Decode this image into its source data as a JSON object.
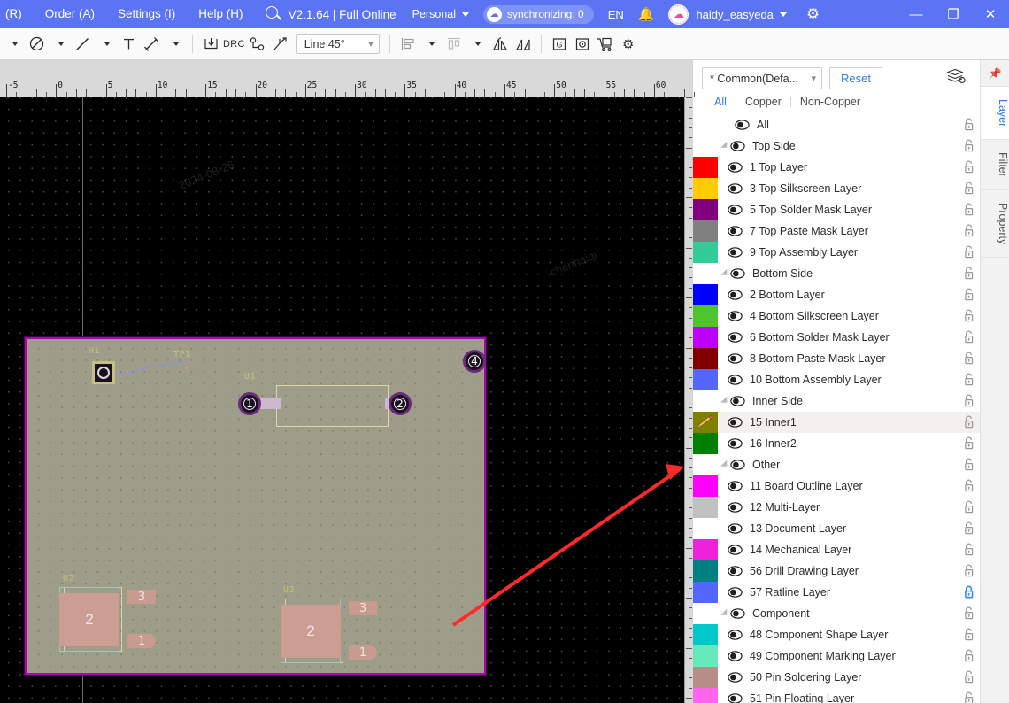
{
  "topbar": {
    "menus": [
      "(R)",
      "Order (A)",
      "Settings (I)",
      "Help (H)"
    ],
    "search_icon": "search-icon",
    "version": "V2.1.64 | Full Online",
    "account_type": "Personal",
    "sync_status": "synchronizing: 0",
    "language": "EN",
    "bell_icon": "bell-icon",
    "username": "haidy_easyeda",
    "gear_icon": "gear-icon",
    "window_minimize": "—",
    "window_restore": "❐",
    "window_close": "✕",
    "bg_color": "#5b74f3"
  },
  "toolbar": {
    "items": [
      {
        "name": "select-tool-caret",
        "glyph": "caret"
      },
      {
        "name": "no-entry-tool",
        "glyph": "circle-slash"
      },
      {
        "name": "no-entry-caret",
        "glyph": "caret"
      },
      {
        "name": "line-tool",
        "glyph": "line"
      },
      {
        "name": "line-caret",
        "glyph": "caret"
      },
      {
        "name": "text-tool",
        "glyph": "T"
      },
      {
        "name": "dimension-tool",
        "glyph": "dimension"
      },
      {
        "name": "dimension-caret",
        "glyph": "caret"
      }
    ],
    "group2": [
      {
        "name": "import-tool",
        "glyph": "import-arrow"
      },
      {
        "name": "drc-tool",
        "glyph": "DRC"
      },
      {
        "name": "net-tool",
        "glyph": "net"
      },
      {
        "name": "route-tool",
        "glyph": "route"
      }
    ],
    "route_mode": "Line 45°",
    "group3": [
      {
        "name": "align-tool",
        "glyph": "align"
      },
      {
        "name": "align-caret",
        "glyph": "caret"
      },
      {
        "name": "distribute-tool",
        "glyph": "distribute"
      },
      {
        "name": "distribute-caret",
        "glyph": "caret"
      },
      {
        "name": "flip-horizontal-tool",
        "glyph": "flip-h"
      },
      {
        "name": "flip-vertical-tool",
        "glyph": "flip-v"
      }
    ],
    "group4": [
      {
        "name": "gerber-export-tool",
        "glyph": "G"
      },
      {
        "name": "bom-tool",
        "glyph": "target-folder"
      },
      {
        "name": "cart-tool",
        "glyph": "cart"
      },
      {
        "name": "settings-tool",
        "glyph": "gear"
      }
    ]
  },
  "canvas": {
    "ruler_unit_labels": [
      "-5",
      "0",
      "5",
      "10",
      "15",
      "20",
      "25",
      "30",
      "35",
      "40",
      "45",
      "50",
      "55",
      "60"
    ],
    "background_color": "#000000",
    "board_fill": "#9d9d8a",
    "board_outline_color": "#b000b0",
    "components": [
      {
        "designator": "H1",
        "type": "mount-hole"
      },
      {
        "designator": "TP1",
        "type": "test-point"
      },
      {
        "designator": "U1",
        "type": "through-hole-ic",
        "pads": [
          "1",
          "2"
        ]
      },
      {
        "designator": "U2",
        "type": "smd",
        "pads": [
          "1",
          "2",
          "3"
        ]
      },
      {
        "designator": "U3",
        "type": "smd",
        "pads": [
          "1",
          "2",
          "3"
        ]
      }
    ],
    "standalone_pads": [
      "4"
    ],
    "annotation_arrow_color": "#ff2a2a"
  },
  "layer_panel": {
    "config_select": "* Common(Defa...",
    "reset_label": "Reset",
    "stack_icon": "layer-stack-icon",
    "filters": [
      "All",
      "Copper",
      "Non-Copper"
    ],
    "active_filter": "All",
    "groups": [
      {
        "name": "All",
        "is_group": false,
        "is_root": true,
        "color": null,
        "children": []
      },
      {
        "name": "Top Side",
        "is_group": true,
        "color": null,
        "children": [
          {
            "name": "1 Top Layer",
            "color": "#ff0000"
          },
          {
            "name": "3 Top Silkscreen Layer",
            "color": "#ffcc00"
          },
          {
            "name": "5 Top Solder Mask Layer",
            "color": "#800080"
          },
          {
            "name": "7 Top Paste Mask Layer",
            "color": "#808080"
          },
          {
            "name": "9 Top Assembly Layer",
            "color": "#33cc99"
          }
        ]
      },
      {
        "name": "Bottom Side",
        "is_group": true,
        "color": null,
        "children": [
          {
            "name": "2 Bottom Layer",
            "color": "#0000ff"
          },
          {
            "name": "4 Bottom Silkscreen Layer",
            "color": "#4cc62c"
          },
          {
            "name": "6 Bottom Solder Mask Layer",
            "color": "#bf00ff"
          },
          {
            "name": "8 Bottom Paste Mask Layer",
            "color": "#800000"
          },
          {
            "name": "10 Bottom Assembly Layer",
            "color": "#5566ff"
          }
        ]
      },
      {
        "name": "Inner Side",
        "is_group": true,
        "color": null,
        "children": [
          {
            "name": "15 Inner1",
            "color": "#808000",
            "selected": true,
            "active_edit": true
          },
          {
            "name": "16 Inner2",
            "color": "#008000"
          }
        ]
      },
      {
        "name": "Other",
        "is_group": true,
        "color": null,
        "children": [
          {
            "name": "11 Board Outline Layer",
            "color": "#ff00ff"
          },
          {
            "name": "12 Multi-Layer",
            "color": "#c0c0c0"
          },
          {
            "name": "13 Document Layer",
            "color": "#ffffff"
          },
          {
            "name": "14 Mechanical Layer",
            "color": "#ee22dd"
          },
          {
            "name": "56 Drill Drawing Layer",
            "color": "#008080"
          },
          {
            "name": "57 Ratline Layer",
            "color": "#5566ff",
            "locked": true
          }
        ]
      },
      {
        "name": "Component",
        "is_group": true,
        "color": null,
        "children": [
          {
            "name": "48 Component Shape Layer",
            "color": "#00c8c8"
          },
          {
            "name": "49 Component Marking Layer",
            "color": "#66e8bb"
          },
          {
            "name": "50 Pin Soldering Layer",
            "color": "#b98c86"
          },
          {
            "name": "51 Pin Floating Layer",
            "color": "#ff66ee"
          }
        ]
      }
    ]
  },
  "side_tabs": {
    "pin_icon": "pin-icon",
    "tabs": [
      "Layer",
      "Filter",
      "Property"
    ],
    "active": "Layer"
  }
}
